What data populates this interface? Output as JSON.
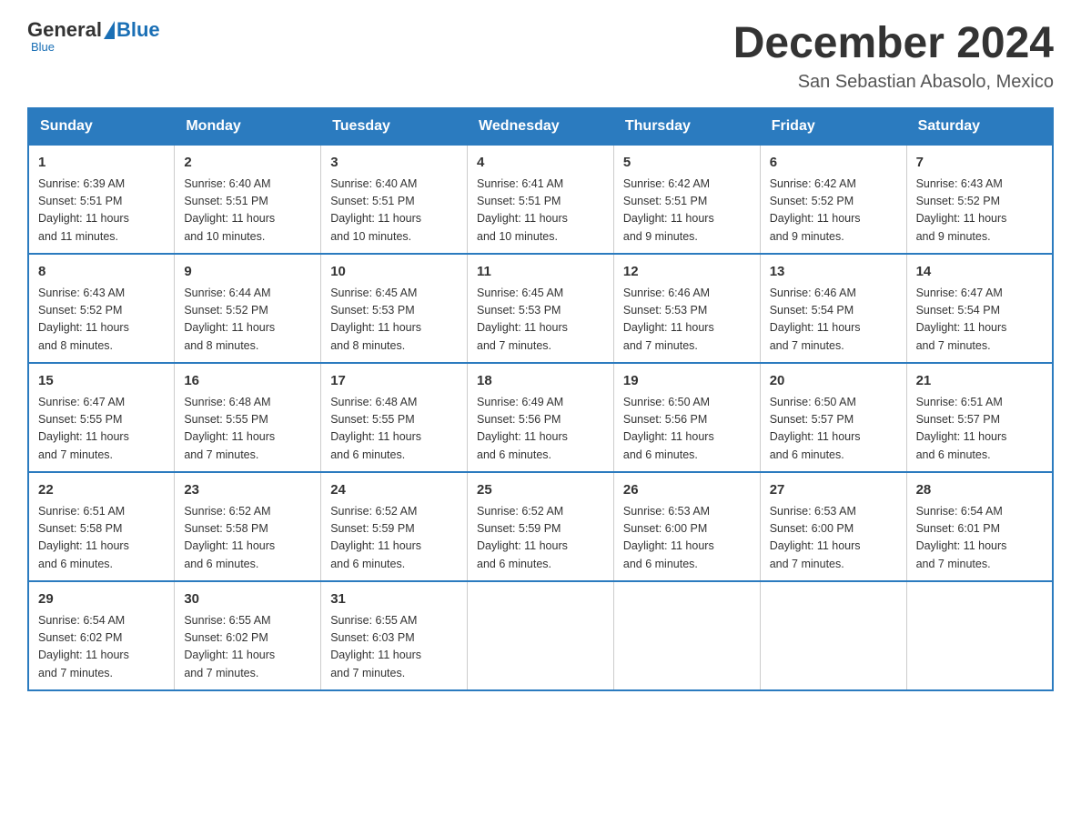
{
  "header": {
    "logo_general": "General",
    "logo_blue": "Blue",
    "month_title": "December 2024",
    "location": "San Sebastian Abasolo, Mexico"
  },
  "weekdays": [
    "Sunday",
    "Monday",
    "Tuesday",
    "Wednesday",
    "Thursday",
    "Friday",
    "Saturday"
  ],
  "weeks": [
    [
      {
        "day": "1",
        "sunrise": "6:39 AM",
        "sunset": "5:51 PM",
        "daylight": "11 hours and 11 minutes."
      },
      {
        "day": "2",
        "sunrise": "6:40 AM",
        "sunset": "5:51 PM",
        "daylight": "11 hours and 10 minutes."
      },
      {
        "day": "3",
        "sunrise": "6:40 AM",
        "sunset": "5:51 PM",
        "daylight": "11 hours and 10 minutes."
      },
      {
        "day": "4",
        "sunrise": "6:41 AM",
        "sunset": "5:51 PM",
        "daylight": "11 hours and 10 minutes."
      },
      {
        "day": "5",
        "sunrise": "6:42 AM",
        "sunset": "5:51 PM",
        "daylight": "11 hours and 9 minutes."
      },
      {
        "day": "6",
        "sunrise": "6:42 AM",
        "sunset": "5:52 PM",
        "daylight": "11 hours and 9 minutes."
      },
      {
        "day": "7",
        "sunrise": "6:43 AM",
        "sunset": "5:52 PM",
        "daylight": "11 hours and 9 minutes."
      }
    ],
    [
      {
        "day": "8",
        "sunrise": "6:43 AM",
        "sunset": "5:52 PM",
        "daylight": "11 hours and 8 minutes."
      },
      {
        "day": "9",
        "sunrise": "6:44 AM",
        "sunset": "5:52 PM",
        "daylight": "11 hours and 8 minutes."
      },
      {
        "day": "10",
        "sunrise": "6:45 AM",
        "sunset": "5:53 PM",
        "daylight": "11 hours and 8 minutes."
      },
      {
        "day": "11",
        "sunrise": "6:45 AM",
        "sunset": "5:53 PM",
        "daylight": "11 hours and 7 minutes."
      },
      {
        "day": "12",
        "sunrise": "6:46 AM",
        "sunset": "5:53 PM",
        "daylight": "11 hours and 7 minutes."
      },
      {
        "day": "13",
        "sunrise": "6:46 AM",
        "sunset": "5:54 PM",
        "daylight": "11 hours and 7 minutes."
      },
      {
        "day": "14",
        "sunrise": "6:47 AM",
        "sunset": "5:54 PM",
        "daylight": "11 hours and 7 minutes."
      }
    ],
    [
      {
        "day": "15",
        "sunrise": "6:47 AM",
        "sunset": "5:55 PM",
        "daylight": "11 hours and 7 minutes."
      },
      {
        "day": "16",
        "sunrise": "6:48 AM",
        "sunset": "5:55 PM",
        "daylight": "11 hours and 7 minutes."
      },
      {
        "day": "17",
        "sunrise": "6:48 AM",
        "sunset": "5:55 PM",
        "daylight": "11 hours and 6 minutes."
      },
      {
        "day": "18",
        "sunrise": "6:49 AM",
        "sunset": "5:56 PM",
        "daylight": "11 hours and 6 minutes."
      },
      {
        "day": "19",
        "sunrise": "6:50 AM",
        "sunset": "5:56 PM",
        "daylight": "11 hours and 6 minutes."
      },
      {
        "day": "20",
        "sunrise": "6:50 AM",
        "sunset": "5:57 PM",
        "daylight": "11 hours and 6 minutes."
      },
      {
        "day": "21",
        "sunrise": "6:51 AM",
        "sunset": "5:57 PM",
        "daylight": "11 hours and 6 minutes."
      }
    ],
    [
      {
        "day": "22",
        "sunrise": "6:51 AM",
        "sunset": "5:58 PM",
        "daylight": "11 hours and 6 minutes."
      },
      {
        "day": "23",
        "sunrise": "6:52 AM",
        "sunset": "5:58 PM",
        "daylight": "11 hours and 6 minutes."
      },
      {
        "day": "24",
        "sunrise": "6:52 AM",
        "sunset": "5:59 PM",
        "daylight": "11 hours and 6 minutes."
      },
      {
        "day": "25",
        "sunrise": "6:52 AM",
        "sunset": "5:59 PM",
        "daylight": "11 hours and 6 minutes."
      },
      {
        "day": "26",
        "sunrise": "6:53 AM",
        "sunset": "6:00 PM",
        "daylight": "11 hours and 6 minutes."
      },
      {
        "day": "27",
        "sunrise": "6:53 AM",
        "sunset": "6:00 PM",
        "daylight": "11 hours and 7 minutes."
      },
      {
        "day": "28",
        "sunrise": "6:54 AM",
        "sunset": "6:01 PM",
        "daylight": "11 hours and 7 minutes."
      }
    ],
    [
      {
        "day": "29",
        "sunrise": "6:54 AM",
        "sunset": "6:02 PM",
        "daylight": "11 hours and 7 minutes."
      },
      {
        "day": "30",
        "sunrise": "6:55 AM",
        "sunset": "6:02 PM",
        "daylight": "11 hours and 7 minutes."
      },
      {
        "day": "31",
        "sunrise": "6:55 AM",
        "sunset": "6:03 PM",
        "daylight": "11 hours and 7 minutes."
      },
      null,
      null,
      null,
      null
    ]
  ],
  "labels": {
    "sunrise": "Sunrise:",
    "sunset": "Sunset:",
    "daylight": "Daylight:"
  }
}
